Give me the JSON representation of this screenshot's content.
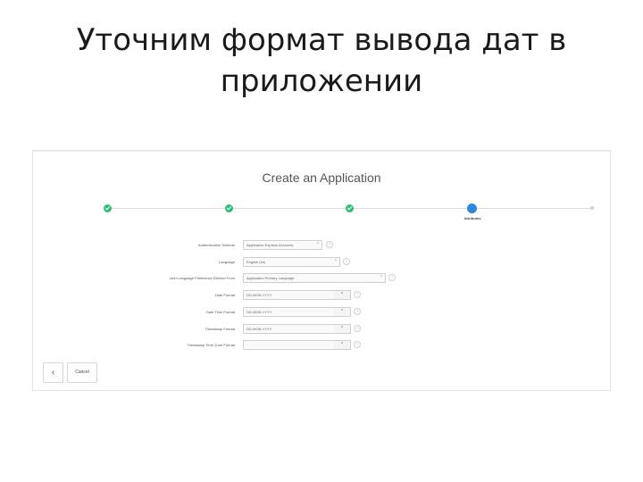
{
  "slide": {
    "title_line1": "Уточним формат вывода дат в",
    "title_line2": "приложении"
  },
  "wizard": {
    "title": "Create an Application",
    "current_step_label": "Attributes",
    "colors": {
      "done": "#2ebd79",
      "current": "#2f86de",
      "pending": "#d0d0d0"
    }
  },
  "form": {
    "rows": [
      {
        "label": "Authentication Scheme",
        "value": "Application Express Accounts",
        "control": "select",
        "chevron-icon": "updown"
      },
      {
        "label": "Language",
        "value": "English (en)",
        "control": "select",
        "chevron-icon": "updown"
      },
      {
        "label": "User Language Preference Derived From",
        "value": "Application Primary Language",
        "control": "select",
        "chevron-icon": "updown"
      },
      {
        "label": "Date Format",
        "value": "DD-MON-YYYY",
        "control": "lov",
        "button_glyph": "^"
      },
      {
        "label": "Date Time Format",
        "value": "DD-MON-YYYY",
        "control": "lov",
        "button_glyph": "^"
      },
      {
        "label": "Timestamp Format",
        "value": "DD-MON-YYYY",
        "control": "lov",
        "button_glyph": "^"
      },
      {
        "label": "Timestamp Time Zone Format",
        "value": "",
        "control": "lov",
        "button_glyph": "^"
      }
    ],
    "help_glyph": "?"
  },
  "footer": {
    "back_glyph": "‹",
    "cancel_label": "Cancel"
  }
}
